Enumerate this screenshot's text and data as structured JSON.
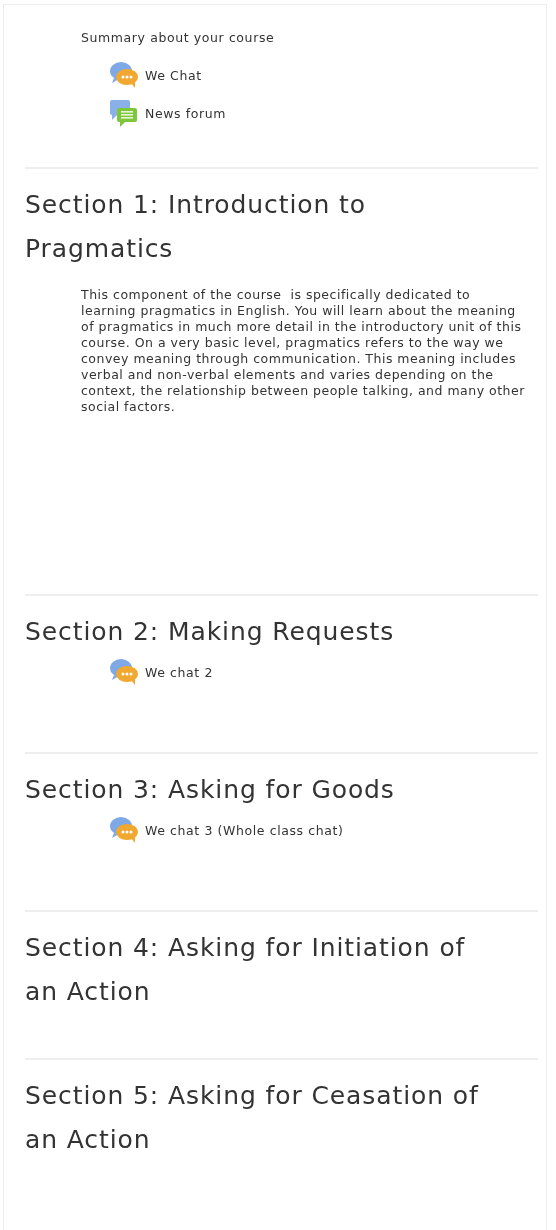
{
  "sections": [
    {
      "summary": "Summary about your course",
      "activities": [
        {
          "kind": "chat",
          "label": "We Chat"
        },
        {
          "kind": "forum",
          "label": "News forum"
        }
      ]
    },
    {
      "title": "Section 1: Introduction to Pragmatics",
      "summary": "This component of the course  is specifically dedicated to learning pragmatics in English. You will learn about the meaning of pragmatics in much more detail in the introductory unit of this course. On a very basic level, pragmatics refers to the way we convey meaning through communication. This meaning includes verbal and non-verbal elements and varies depending on the context, the relationship between people talking, and many other social factors."
    },
    {
      "title": "Section 2: Making Requests",
      "activities": [
        {
          "kind": "chat",
          "label": "We chat 2"
        }
      ]
    },
    {
      "title": "Section 3: Asking for Goods",
      "activities": [
        {
          "kind": "chat",
          "label": "We chat 3 (Whole class chat)"
        }
      ]
    },
    {
      "title": "Section 4: Asking for Initiation of an Action"
    },
    {
      "title": "Section 5: Asking for Ceasation of an Action"
    }
  ]
}
